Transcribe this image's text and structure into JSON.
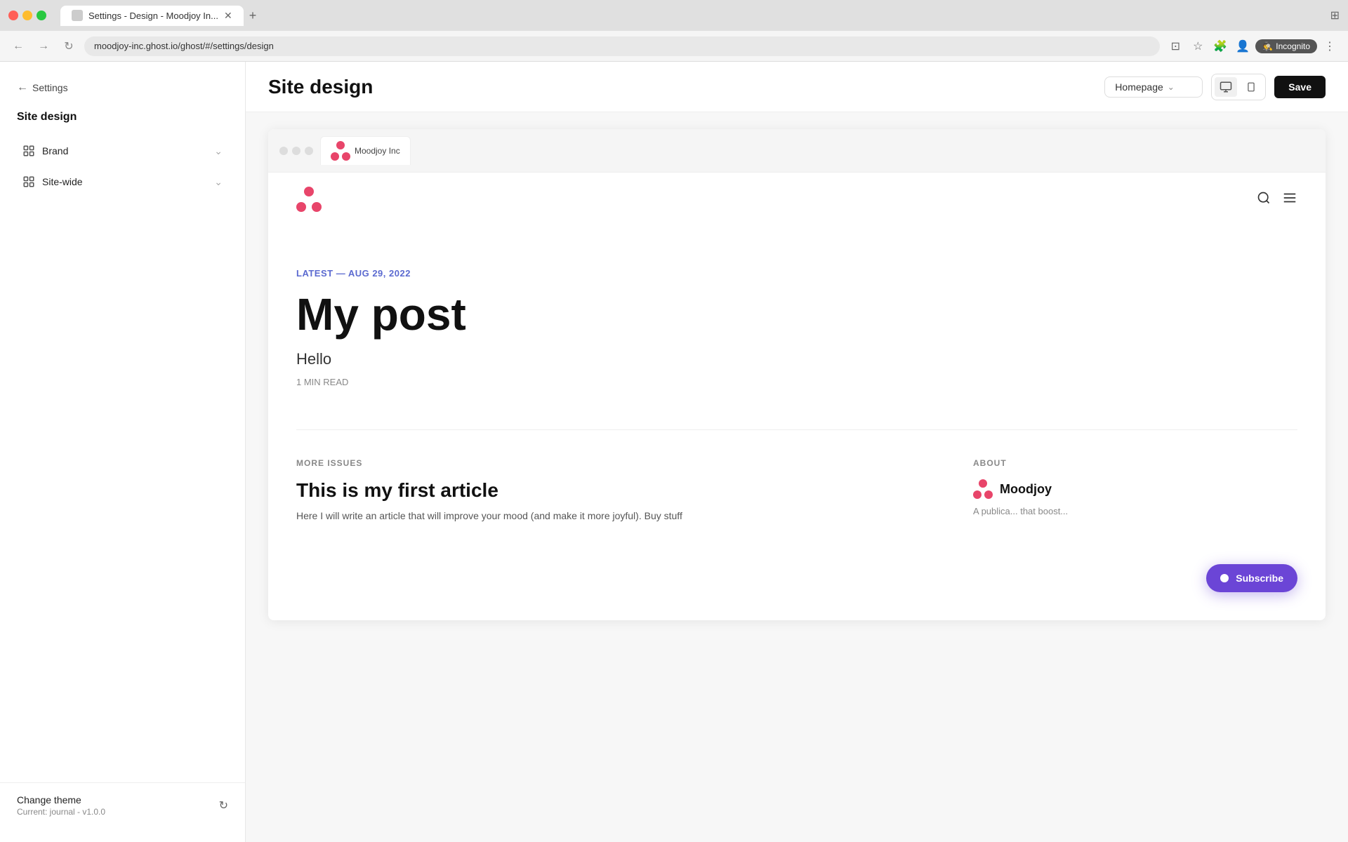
{
  "browser": {
    "tab_title": "Settings - Design - Moodjoy In...",
    "address": "moodjoy-inc.ghost.io/ghost/#/settings/design",
    "incognito_label": "Incognito"
  },
  "sidebar": {
    "back_label": "Settings",
    "title": "Site design",
    "items": [
      {
        "id": "brand",
        "label": "Brand",
        "icon": "edit"
      },
      {
        "id": "site-wide",
        "label": "Site-wide",
        "icon": "grid"
      }
    ],
    "footer": {
      "change_theme_label": "Change theme",
      "current_theme": "Current: journal - v1.0.0"
    }
  },
  "header": {
    "title": "Site design",
    "view_selector_label": "Homepage",
    "save_label": "Save"
  },
  "preview": {
    "tab_label": "Moodjoy Inc",
    "site": {
      "tag": "LATEST — AUG 29, 2022",
      "post_title": "My post",
      "post_subtitle": "Hello",
      "read_time": "1 MIN READ",
      "more_issues_label": "MORE ISSUES",
      "about_label": "ABOUT",
      "article_title": "This is my first article",
      "article_excerpt": "Here I will write an article that will improve your mood (and make it more joyful). Buy stuff",
      "about_site_name": "Moodjoy",
      "about_site_desc": "A publica... that boost..."
    },
    "subscribe_label": "Subscribe"
  }
}
